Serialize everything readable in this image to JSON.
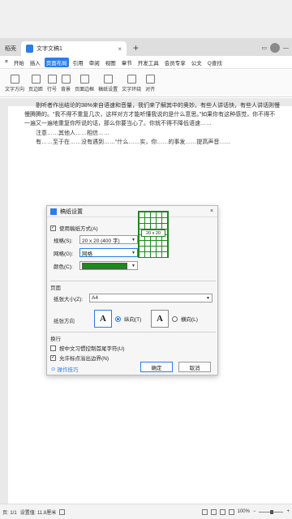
{
  "tabs": [
    {
      "label": "稻壳"
    },
    {
      "label": "文字文稿1"
    }
  ],
  "tabbar": {
    "plus": "+"
  },
  "menubar": {
    "items": [
      "≡",
      "开始",
      "插入",
      "页面布局",
      "引用",
      "审阅",
      "视图",
      "章节",
      "开发工具",
      "会员专享",
      "公文"
    ],
    "active_index": 3,
    "search": "Q查找"
  },
  "ribbon": {
    "groups": [
      "文字方向",
      "页边距",
      "行号",
      "背景",
      "页面边框",
      "稿纸设置",
      "文字环绕",
      "对齐"
    ]
  },
  "document": {
    "paragraphs": [
      "剔听者作出结论的38%来自语速和音量，我们来了解其中的奥妙。有些人讲话快，有些人讲话则慢慢腾腾的。“我不得不重复几次，这样对方才能听懂我说的是什么意思。”如果你有这种感觉，你不得不一遍又一遍地重复你所说的话，那么你要当心了。你就不得不降低语速……",
      "注意……其他人……相信……",
      "有……至于在……没有遇到……“什么……实，你……的事发……提高声音……"
    ]
  },
  "dialog": {
    "title": "稿纸设置",
    "use_grid_label": "使用稿纸方式(A)",
    "use_grid_checked": true,
    "spec_label": "规格(S):",
    "spec_value": "20 x 20 (400 字)",
    "grid_label": "网格(G):",
    "grid_value": "网格",
    "color_label": "颜色(C):",
    "color_value": "#1a8a1a",
    "preview_label": "20 x 20",
    "page_section": "页面",
    "paper_size_label": "纸张大小(Z):",
    "paper_size_value": "A4",
    "orientation_label": "纸张方向",
    "portrait_label": "纵向(T)",
    "landscape_label": "横向(L)",
    "orientation_glyph": "A",
    "orientation_selected": "portrait",
    "wrap_section": "换行",
    "chk1_label": "按中文习惯控制首尾字符(U)",
    "chk1_checked": false,
    "chk2_label": "允许标点溢出边界(N)",
    "chk2_checked": true,
    "help_link": "操作技巧",
    "ok": "确定",
    "cancel": "取消",
    "close": "×"
  },
  "statusbar": {
    "page": "页: 1/1",
    "words": "设置值: 11.8厘米",
    "zoom": "100%"
  }
}
